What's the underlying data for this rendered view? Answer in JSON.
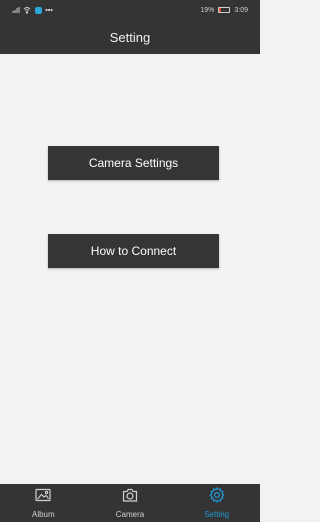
{
  "status_bar": {
    "battery_percent": "19%",
    "time": "3:09",
    "battery_level": 0.19,
    "battery_color": "#e64a3a",
    "icons": [
      "signal-icon",
      "wifi-icon",
      "app-icon",
      "ellipsis-icon"
    ]
  },
  "header": {
    "title": "Setting"
  },
  "main": {
    "buttons": [
      {
        "label": "Camera Settings"
      },
      {
        "label": "How to Connect"
      }
    ]
  },
  "bottom_nav": {
    "items": [
      {
        "label": "Album",
        "icon": "image-icon",
        "active": false
      },
      {
        "label": "Camera",
        "icon": "camera-icon",
        "active": false
      },
      {
        "label": "Setting",
        "icon": "gear-icon",
        "active": true
      }
    ]
  },
  "colors": {
    "bar_background": "#343434",
    "button_background": "#353535",
    "content_background": "#f2f2f2",
    "accent": "#1e9ad6",
    "nav_inactive": "#d0d0d0"
  }
}
